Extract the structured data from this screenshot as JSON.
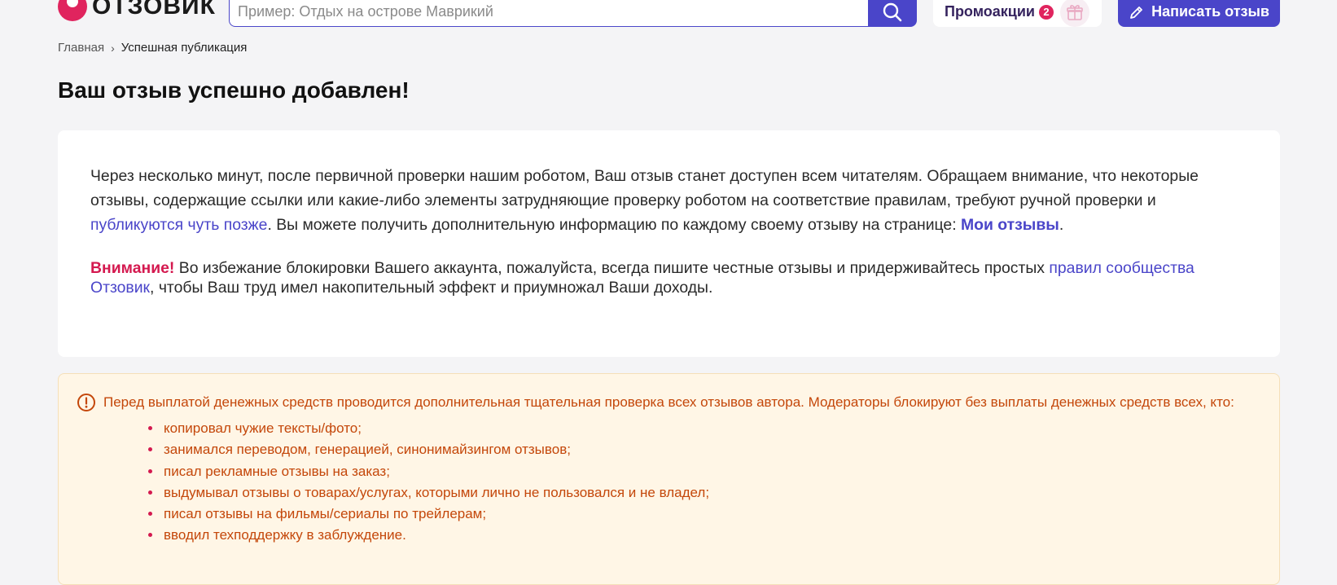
{
  "header": {
    "logo_text": "ОТЗОВИК",
    "search_placeholder": "Пример: Отдых на острове Маврикий",
    "promo_label": "Промоакции",
    "promo_count": "2",
    "write_label": "Написать отзыв",
    "icons": {
      "search": "search-icon",
      "gift": "gift-icon",
      "pencil": "pencil-icon"
    }
  },
  "breadcrumb": {
    "home": "Главная",
    "separator": "›",
    "current": "Успешная публикация"
  },
  "page_title": "Ваш отзыв успешно добавлен!",
  "notice": {
    "p1_part1": "Через несколько минут, после первичной проверки нашим роботом, Ваш отзыв станет доступен всем читателям. Обращаем внимание, что некоторые отзывы, содержащие ссылки или какие-либо элементы затрудняющие проверку роботом на соответствие правилам, требуют ручной проверки и ",
    "p1_link": "публикуются чуть позже",
    "p1_part2": ". Вы можете получить дополнительную информацию по каждому своему отзыву на странице: ",
    "p1_link2": "Мои отзывы",
    "p1_end": ".",
    "attention_label": "Внимание!",
    "p2_part1": " Во избежание блокировки Вашего аккаунта, пожалуйста, всегда пишите честные отзывы и придерживайтесь простых ",
    "p2_link": "правил сообщества Отзовик",
    "p2_part2": ", чтобы Ваш труд имел накопительный эффект и приумножал Ваши доходы."
  },
  "warning": {
    "icon": "exclamation-circle-icon",
    "text": "Перед выплатой денежных средств проводится дополнительная тщательная проверка всех отзывов автора. Модераторы блокируют без выплаты денежных средств всех, кто:",
    "items": [
      "копировал чужие тексты/фото;",
      "занимался переводом, генерацией, синонимайзингом отзывов;",
      "писал рекламные отзывы на заказ;",
      "выдумывал отзывы о товарах/услугах, которыми лично не пользовался и не владел;",
      "писал отзывы на фильмы/сериалы по трейлерам;",
      "вводил техподдержку в заблуждение."
    ]
  },
  "colors": {
    "brand": "#e0245e",
    "accent": "#4a45c9",
    "warning_text": "#c4470a",
    "warning_bg": "#fff6e6"
  }
}
